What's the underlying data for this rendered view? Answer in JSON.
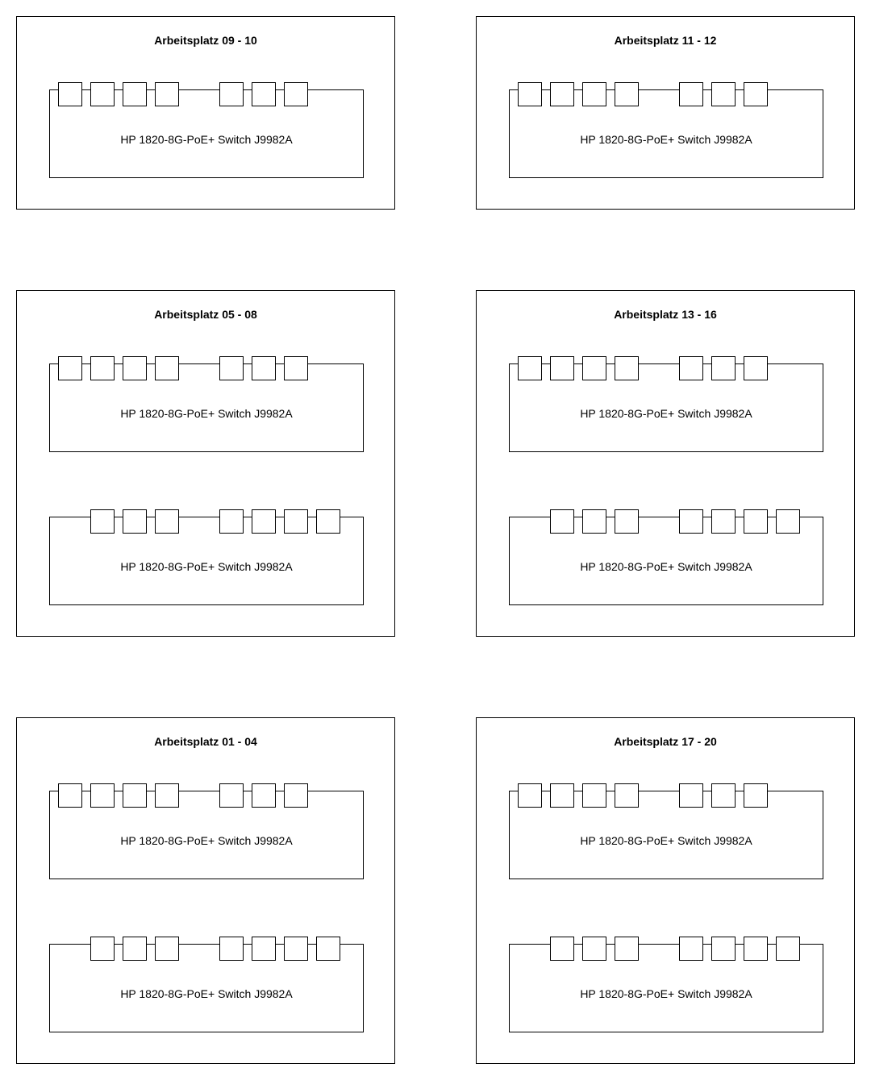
{
  "port_layouts": {
    "top": [
      0,
      1,
      2,
      3,
      5,
      6,
      7
    ],
    "bottom": [
      1,
      2,
      3,
      5,
      6,
      7,
      8
    ]
  },
  "workstations": [
    {
      "id": "ws-09-10",
      "title": "Arbeitsplatz 09 - 10",
      "switches": [
        {
          "label": "HP 1820-8G-PoE+ Switch J9982A",
          "layout": "top"
        }
      ]
    },
    {
      "id": "ws-11-12",
      "title": "Arbeitsplatz 11 - 12",
      "switches": [
        {
          "label": "HP 1820-8G-PoE+ Switch J9982A",
          "layout": "top"
        }
      ]
    },
    {
      "id": "ws-05-08",
      "title": "Arbeitsplatz 05 - 08",
      "switches": [
        {
          "label": "HP 1820-8G-PoE+ Switch J9982A",
          "layout": "top"
        },
        {
          "label": "HP 1820-8G-PoE+ Switch J9982A",
          "layout": "bottom"
        }
      ]
    },
    {
      "id": "ws-13-16",
      "title": "Arbeitsplatz 13 - 16",
      "switches": [
        {
          "label": "HP 1820-8G-PoE+ Switch J9982A",
          "layout": "top"
        },
        {
          "label": "HP 1820-8G-PoE+ Switch J9982A",
          "layout": "bottom"
        }
      ]
    },
    {
      "id": "ws-01-04",
      "title": "Arbeitsplatz 01 - 04",
      "switches": [
        {
          "label": "HP 1820-8G-PoE+ Switch J9982A",
          "layout": "top"
        },
        {
          "label": "HP 1820-8G-PoE+ Switch J9982A",
          "layout": "bottom"
        }
      ]
    },
    {
      "id": "ws-17-20",
      "title": "Arbeitsplatz 17 - 20",
      "switches": [
        {
          "label": "HP 1820-8G-PoE+ Switch J9982A",
          "layout": "top"
        },
        {
          "label": "HP 1820-8G-PoE+ Switch J9982A",
          "layout": "bottom"
        }
      ]
    }
  ]
}
